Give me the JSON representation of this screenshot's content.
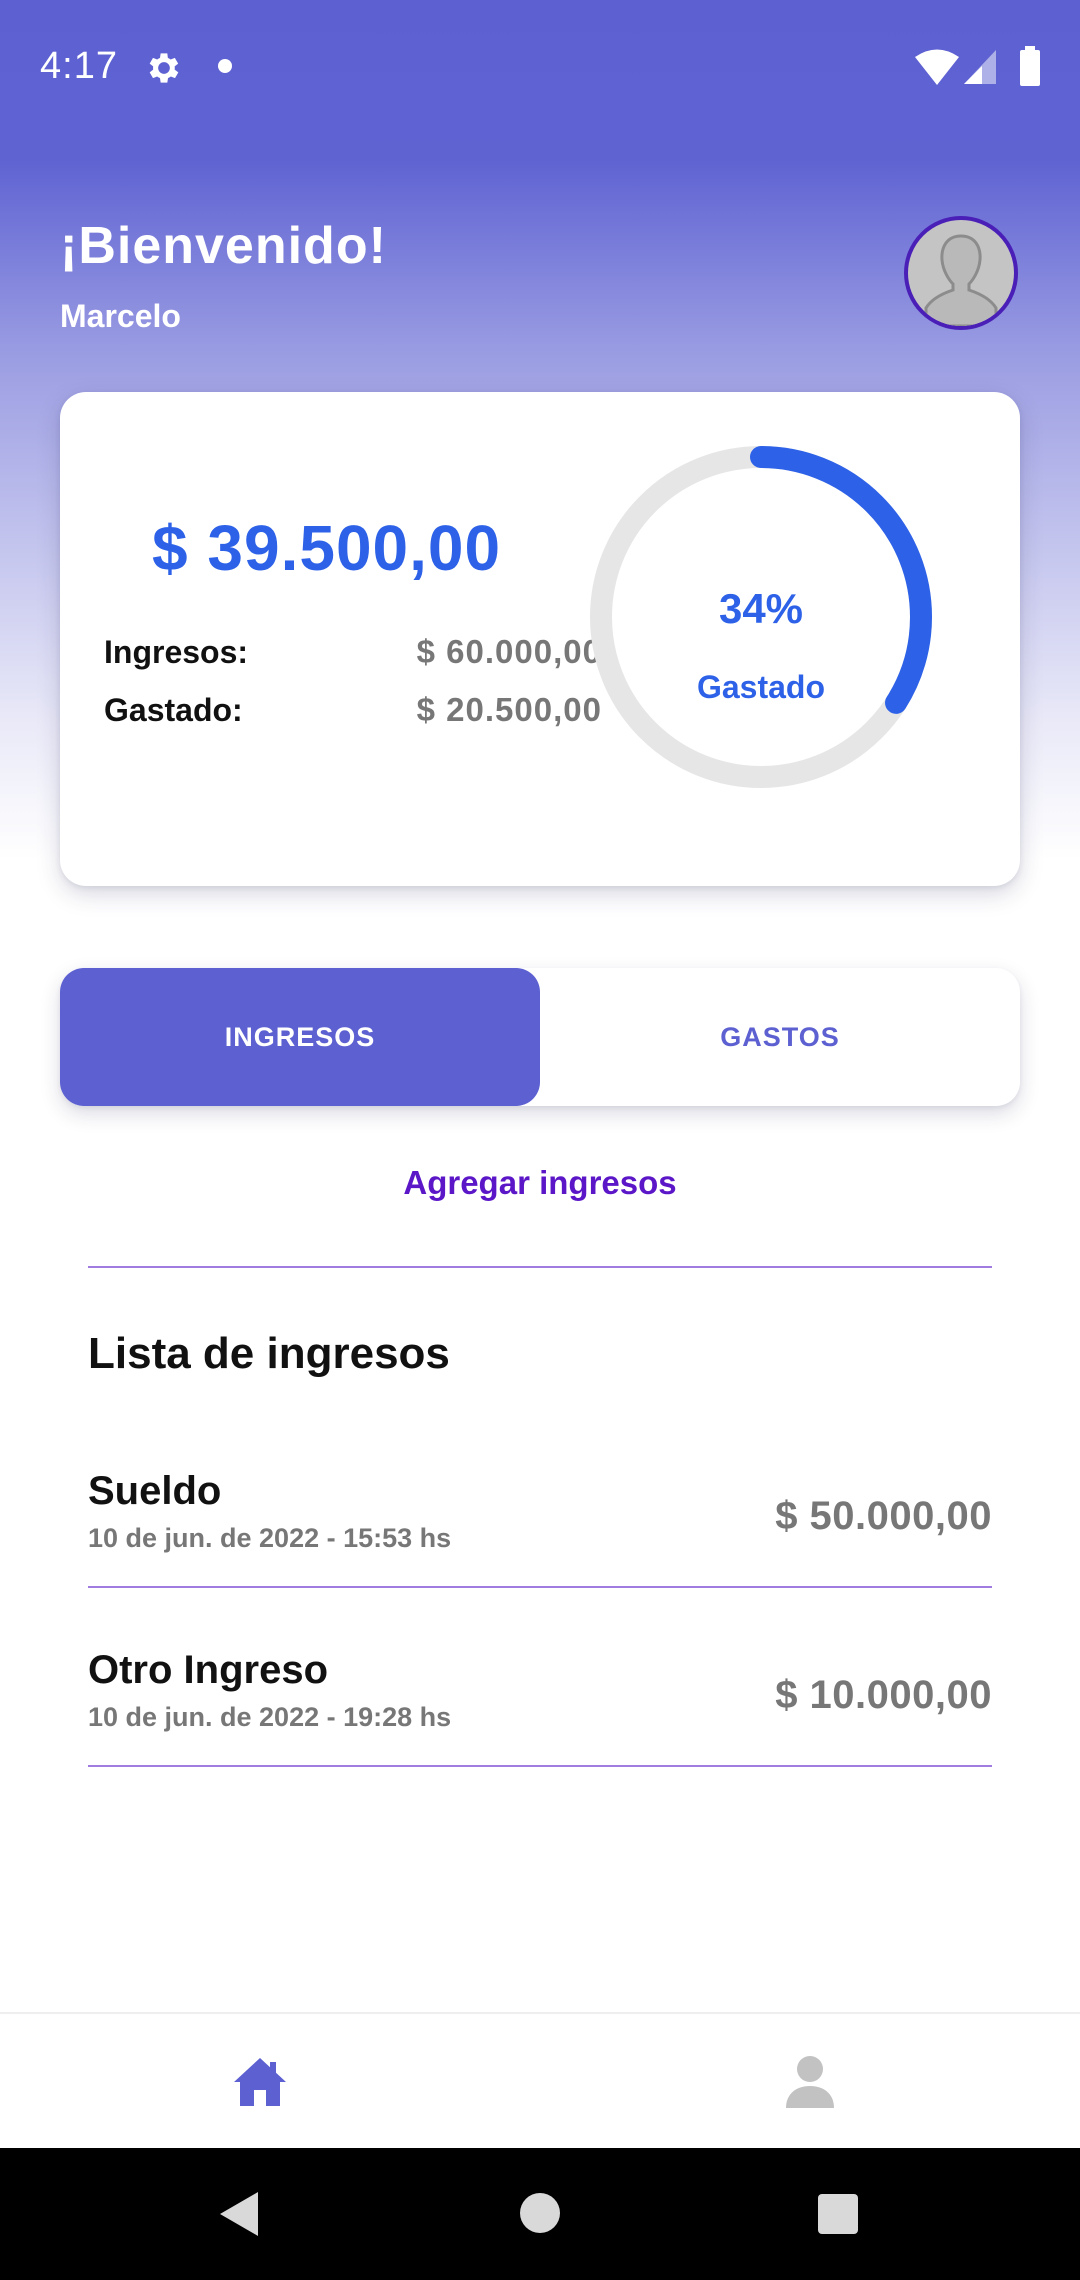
{
  "status_bar": {
    "time": "4:17",
    "icons": [
      "gear-icon",
      "notification-dot",
      "wifi-icon",
      "signal-icon",
      "battery-icon"
    ]
  },
  "header": {
    "title": "¡Bienvenido!",
    "user_name": "Marcelo",
    "avatar_icon": "user-silhouette-icon"
  },
  "summary": {
    "balance": "$ 39.500,00",
    "rows": [
      {
        "label": "Ingresos:",
        "value": "$ 60.000,00"
      },
      {
        "label": "Gastado:",
        "value": "$ 20.500,00"
      }
    ],
    "progress_fraction": 0.34,
    "progress_text": "34%",
    "progress_caption": "Gastado"
  },
  "tabs": [
    {
      "label": "INGRESOS",
      "active": true
    },
    {
      "label": "GASTOS",
      "active": false
    }
  ],
  "add_link": "Agregar ingresos",
  "list": {
    "title": "Lista de ingresos",
    "items": [
      {
        "name": "Sueldo",
        "date": "10 de jun. de 2022 - 15:53 hs",
        "amount": "$ 50.000,00"
      },
      {
        "name": "Otro Ingreso",
        "date": "10 de jun. de 2022 - 19:28 hs",
        "amount": "$ 10.000,00"
      }
    ]
  },
  "bottom_nav": {
    "items": [
      "home-icon",
      "profile-icon"
    ],
    "active": "home-icon"
  },
  "colors": {
    "primary": "#5c60d1",
    "accent_blue": "#2d62e8",
    "link_purple": "#5b16c8",
    "divider": "#a07be0",
    "ring_track": "#e6e6e6"
  }
}
